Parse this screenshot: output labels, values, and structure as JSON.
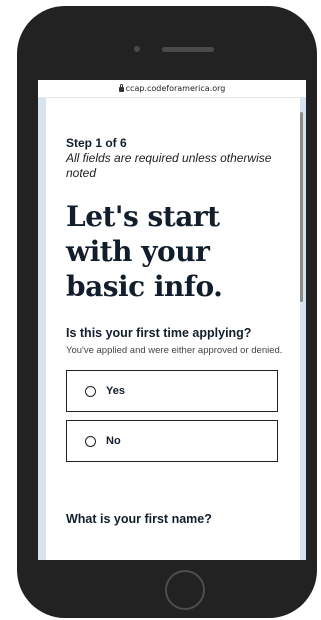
{
  "browser": {
    "url": "ccap.codeforamerica.org"
  },
  "form": {
    "step": "Step 1 of 6",
    "note": "All fields are required unless otherwise noted",
    "title": "Let's start with your basic info.",
    "question1": {
      "label": "Is this your first time applying?",
      "help": "You've applied and were either approved or denied.",
      "options": [
        {
          "label": "Yes"
        },
        {
          "label": "No"
        }
      ]
    },
    "question2": {
      "label": "What is your first name?"
    }
  }
}
